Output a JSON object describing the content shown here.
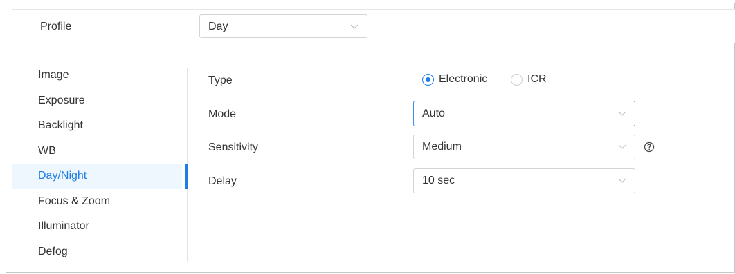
{
  "profile": {
    "label": "Profile",
    "value": "Day"
  },
  "nav": {
    "items": [
      {
        "label": "Image"
      },
      {
        "label": "Exposure"
      },
      {
        "label": "Backlight"
      },
      {
        "label": "WB"
      },
      {
        "label": "Day/Night",
        "active": true
      },
      {
        "label": "Focus & Zoom"
      },
      {
        "label": "Illuminator"
      },
      {
        "label": "Defog"
      }
    ]
  },
  "form": {
    "type": {
      "label": "Type",
      "options": [
        {
          "label": "Electronic",
          "checked": true
        },
        {
          "label": "ICR",
          "checked": false
        }
      ]
    },
    "mode": {
      "label": "Mode",
      "value": "Auto"
    },
    "sensitivity": {
      "label": "Sensitivity",
      "value": "Medium",
      "help_icon": "question-circle-icon"
    },
    "delay": {
      "label": "Delay",
      "value": "10 sec"
    }
  },
  "colors": {
    "accent": "#1e7ee4",
    "active_bg": "#eef6fe",
    "border": "#d4d4d4",
    "text": "#333333"
  }
}
